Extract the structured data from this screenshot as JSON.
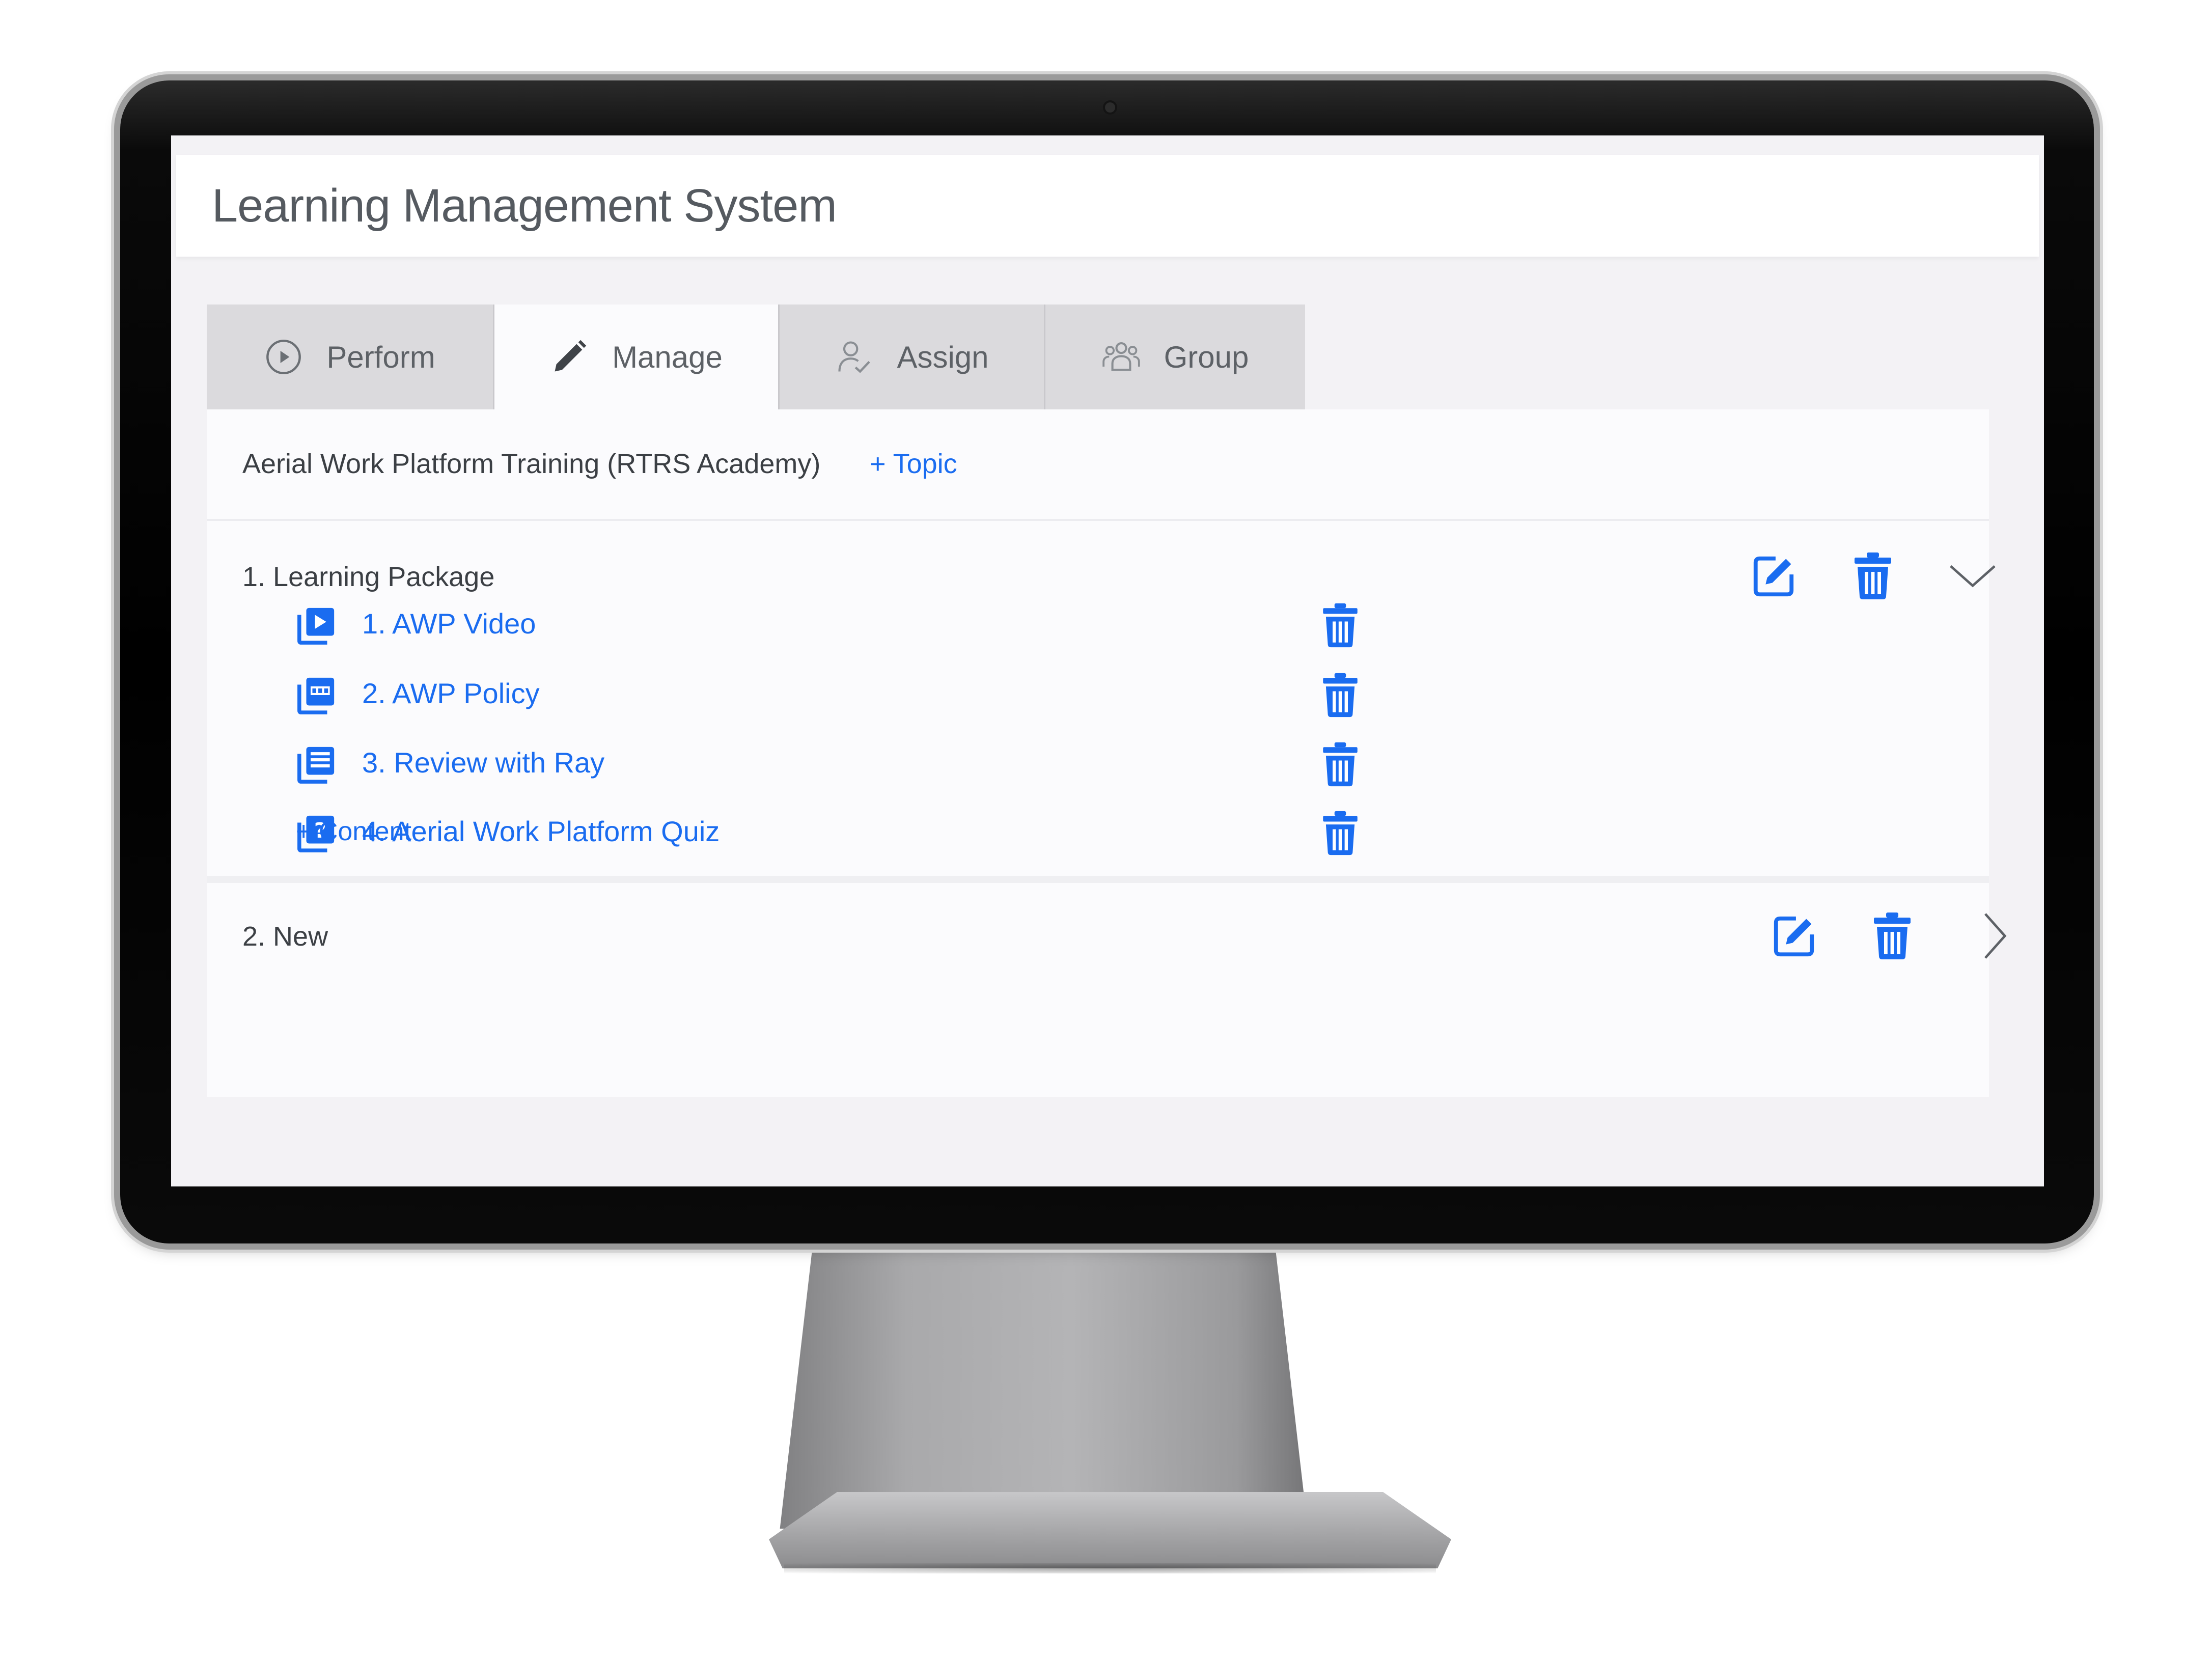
{
  "app": {
    "title": "Learning Management System"
  },
  "tabs": [
    {
      "label": "Perform",
      "icon": "play-circle-icon",
      "active": false
    },
    {
      "label": "Manage",
      "icon": "pencil-icon",
      "active": true
    },
    {
      "label": "Assign",
      "icon": "user-assign-icon",
      "active": false
    },
    {
      "label": "Group",
      "icon": "users-group-icon",
      "active": false
    }
  ],
  "course": {
    "title": "Aerial Work Platform Training (RTRS Academy)",
    "add_topic_label": "+ Topic"
  },
  "topics": [
    {
      "title": "1. Learning Package",
      "expanded": true,
      "items": [
        {
          "label": "1. AWP Video",
          "icon": "video-icon"
        },
        {
          "label": "2. AWP Policy",
          "icon": "pdf-icon"
        },
        {
          "label": "3. Review with Ray",
          "icon": "document-list-icon"
        },
        {
          "label": "4. Aerial Work Platform Quiz",
          "icon": "quiz-icon"
        }
      ],
      "add_content_label": "+ Content"
    },
    {
      "title": "2. New",
      "expanded": false
    }
  ],
  "colors": {
    "accent": "#1a6cf0",
    "tab_bg": "#dbdadd",
    "tab_active_bg": "#fbfbfd",
    "text": "#3b3f44"
  }
}
